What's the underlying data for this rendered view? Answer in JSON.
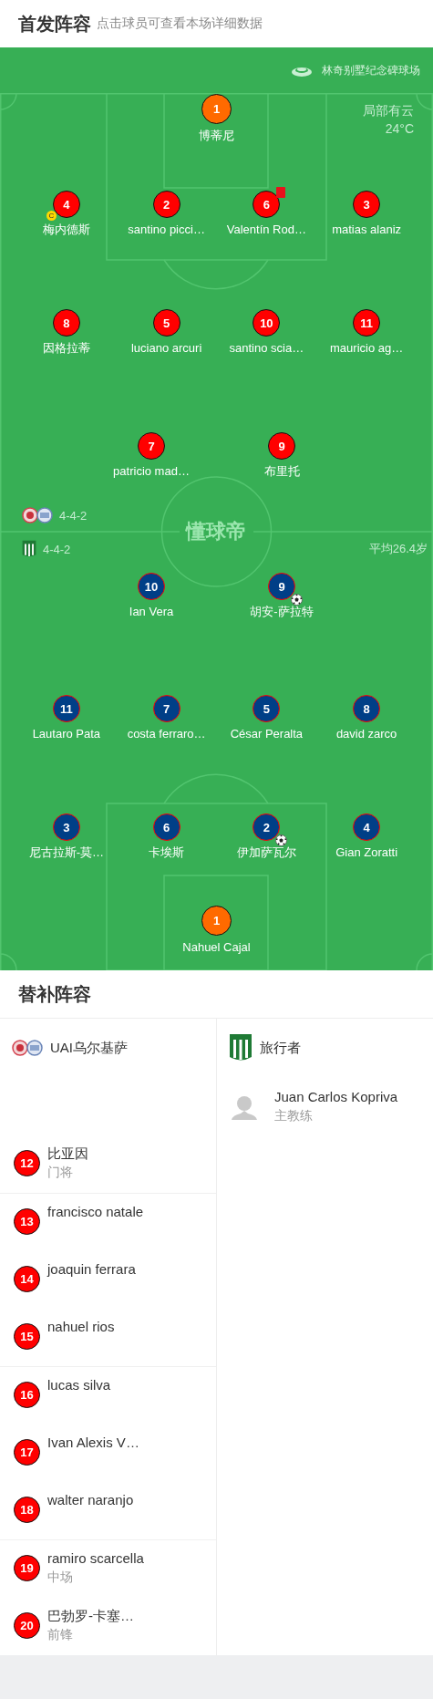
{
  "header": {
    "title": "首发阵容",
    "subtitle": "点击球员可查看本场详细数据"
  },
  "pitch": {
    "stadium": "林奇别墅纪念碑球场",
    "weather": "局部有云",
    "temperature": "24°C",
    "logo_text": "懂球帝",
    "captain_label": "C",
    "teams": [
      {
        "kind": "home",
        "formation": "4-4-2",
        "lines": [
          [
            {
              "number": "1",
              "name": "博蒂尼",
              "kind": "goalkeeper",
              "captain": false,
              "red_card": false,
              "goal": false
            }
          ],
          [
            {
              "number": "4",
              "name": "梅内德斯",
              "kind": "outfield",
              "captain": true,
              "red_card": false,
              "goal": false
            },
            {
              "number": "2",
              "name": "santino picci…",
              "kind": "outfield",
              "captain": false,
              "red_card": false,
              "goal": false
            },
            {
              "number": "6",
              "name": "Valentín Rod…",
              "kind": "outfield",
              "captain": false,
              "red_card": true,
              "goal": false
            },
            {
              "number": "3",
              "name": "matias alaniz",
              "kind": "outfield",
              "captain": false,
              "red_card": false,
              "goal": false
            }
          ],
          [
            {
              "number": "8",
              "name": "因格拉蒂",
              "kind": "outfield",
              "captain": false,
              "red_card": false,
              "goal": false
            },
            {
              "number": "5",
              "name": "luciano arcuri",
              "kind": "outfield",
              "captain": false,
              "red_card": false,
              "goal": false
            },
            {
              "number": "10",
              "name": "santino scia…",
              "kind": "outfield",
              "captain": false,
              "red_card": false,
              "goal": false
            },
            {
              "number": "11",
              "name": "mauricio ag…",
              "kind": "outfield",
              "captain": false,
              "red_card": false,
              "goal": false
            }
          ],
          [
            {
              "number": "7",
              "name": "patricio mad…",
              "kind": "outfield",
              "captain": false,
              "red_card": false,
              "goal": false
            },
            {
              "number": "9",
              "name": "布里托",
              "kind": "outfield",
              "captain": false,
              "red_card": false,
              "goal": false
            }
          ]
        ]
      },
      {
        "kind": "away",
        "formation": "4-4-2",
        "average_age": "平均26.4岁",
        "lines": [
          [
            {
              "number": "10",
              "name": "Ian Vera",
              "kind": "outfield",
              "captain": false,
              "red_card": false,
              "goal": false
            },
            {
              "number": "9",
              "name": "胡安-萨拉特",
              "kind": "outfield",
              "captain": false,
              "red_card": false,
              "goal": true
            }
          ],
          [
            {
              "number": "11",
              "name": "Lautaro Pata",
              "kind": "outfield",
              "captain": false,
              "red_card": false,
              "goal": false
            },
            {
              "number": "7",
              "name": "costa ferraro…",
              "kind": "outfield",
              "captain": false,
              "red_card": false,
              "goal": false
            },
            {
              "number": "5",
              "name": "César Peralta",
              "kind": "outfield",
              "captain": false,
              "red_card": false,
              "goal": false
            },
            {
              "number": "8",
              "name": "david zarco",
              "kind": "outfield",
              "captain": false,
              "red_card": false,
              "goal": false
            }
          ],
          [
            {
              "number": "3",
              "name": "尼古拉斯-莫…",
              "kind": "outfield",
              "captain": false,
              "red_card": false,
              "goal": false
            },
            {
              "number": "6",
              "name": "卡埃斯",
              "kind": "outfield",
              "captain": false,
              "red_card": false,
              "goal": false
            },
            {
              "number": "2",
              "name": "伊加萨瓦尔",
              "kind": "outfield",
              "captain": false,
              "red_card": false,
              "goal": true
            },
            {
              "number": "4",
              "name": "Gian Zoratti",
              "kind": "outfield",
              "captain": false,
              "red_card": false,
              "goal": false
            }
          ],
          [
            {
              "number": "1",
              "name": "Nahuel Cajal",
              "kind": "goalkeeper",
              "captain": false,
              "red_card": false,
              "goal": false
            }
          ]
        ]
      }
    ]
  },
  "substitutes": {
    "title": "替补阵容",
    "teams": [
      {
        "kind": "home",
        "name": "UAI乌尔基萨",
        "groups": [
          [
            {
              "number": "12",
              "name": "比亚因",
              "position": "门将"
            }
          ],
          [
            {
              "number": "13",
              "name": "francisco natale"
            },
            {
              "number": "14",
              "name": "joaquin ferrara"
            },
            {
              "number": "15",
              "name": "nahuel rios"
            }
          ],
          [
            {
              "number": "16",
              "name": "lucas silva"
            },
            {
              "number": "17",
              "name": "Ivan Alexis V…"
            },
            {
              "number": "18",
              "name": "walter naranjo"
            }
          ],
          [
            {
              "number": "19",
              "name": "ramiro scarcella",
              "position": "中场"
            },
            {
              "number": "20",
              "name": "巴勃罗-卡塞…",
              "position": "前锋"
            }
          ]
        ]
      },
      {
        "kind": "away",
        "name": "旅行者",
        "coach": {
          "name": "Juan Carlos Kopriva",
          "role": "主教练"
        }
      }
    ]
  }
}
